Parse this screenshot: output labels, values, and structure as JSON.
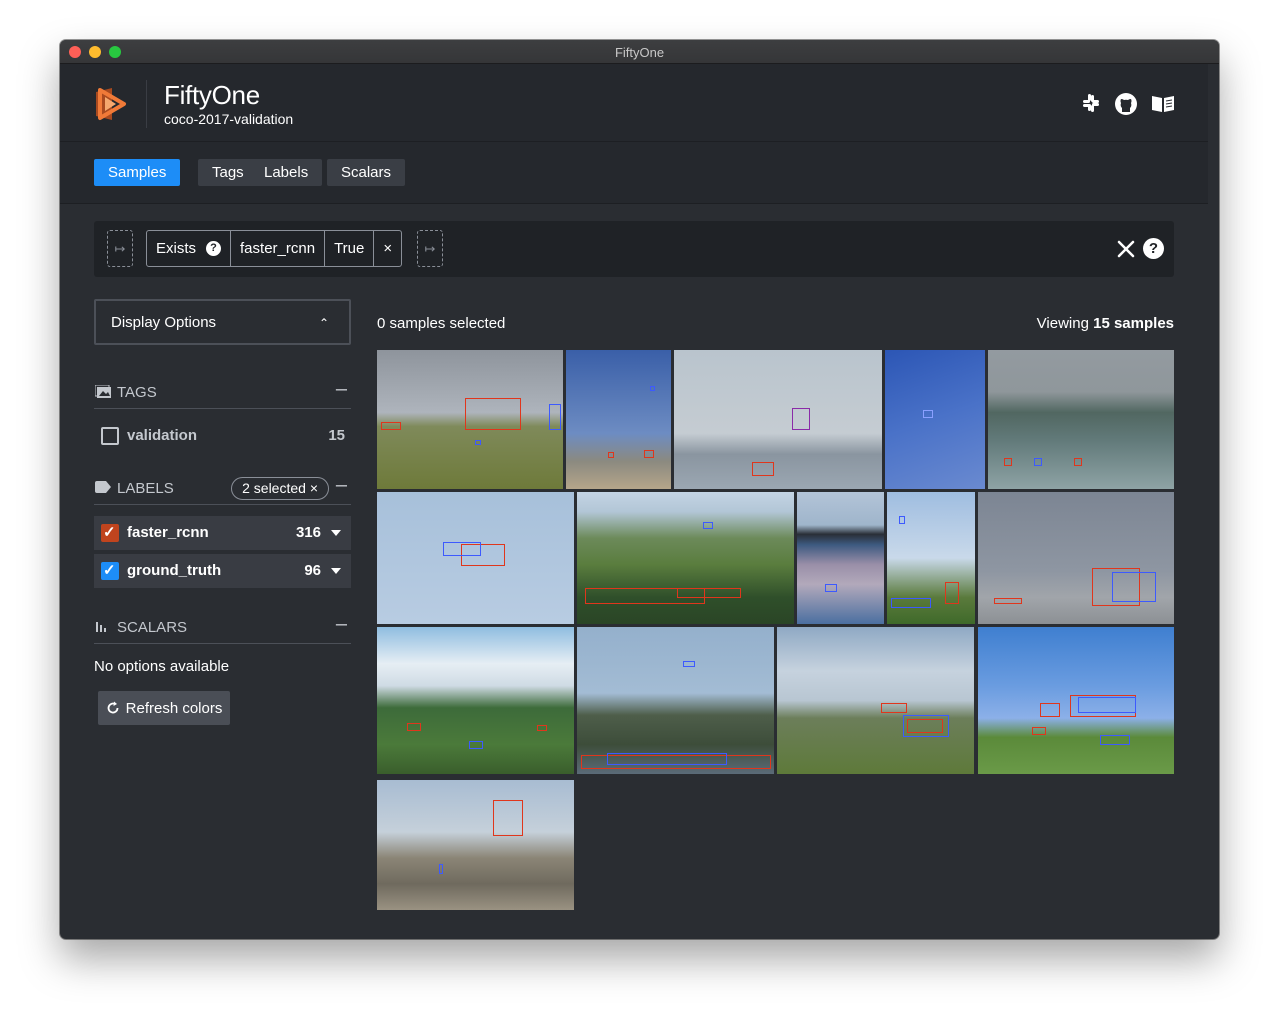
{
  "window": {
    "title": "FiftyOne"
  },
  "header": {
    "app_name": "FiftyOne",
    "dataset": "coco-2017-validation",
    "icons": [
      "slack-icon",
      "github-icon",
      "docs-book-icon"
    ]
  },
  "tabs": [
    {
      "label": "Samples",
      "active": true
    },
    {
      "label": "Tags",
      "active": false
    },
    {
      "label": "Labels",
      "active": false
    },
    {
      "label": "Scalars",
      "active": false
    }
  ],
  "filter": {
    "stage": "Exists",
    "field": "faster_rcnn",
    "value": "True",
    "remove": "×"
  },
  "sidebar": {
    "display_options": "Display Options",
    "tags": {
      "title": "TAGS",
      "items": [
        {
          "label": "validation",
          "count": "15",
          "checked": false
        }
      ]
    },
    "labels": {
      "title": "LABELS",
      "badge": "2 selected ×",
      "items": [
        {
          "label": "faster_rcnn",
          "count": "316",
          "checked": true,
          "color": "#c0441e"
        },
        {
          "label": "ground_truth",
          "count": "96",
          "checked": true,
          "color": "#1d8df7"
        }
      ]
    },
    "scalars": {
      "title": "SCALARS",
      "empty": "No options available"
    },
    "refresh": "Refresh colors"
  },
  "grid": {
    "selected_text": "0 samples selected",
    "viewing_prefix": "Viewing ",
    "viewing_count": "15 samples"
  },
  "colors": {
    "accent": "#1d8df7",
    "prediction": "#e0361c",
    "ground_truth": "#3d5afe",
    "background": "#2a2d32"
  }
}
